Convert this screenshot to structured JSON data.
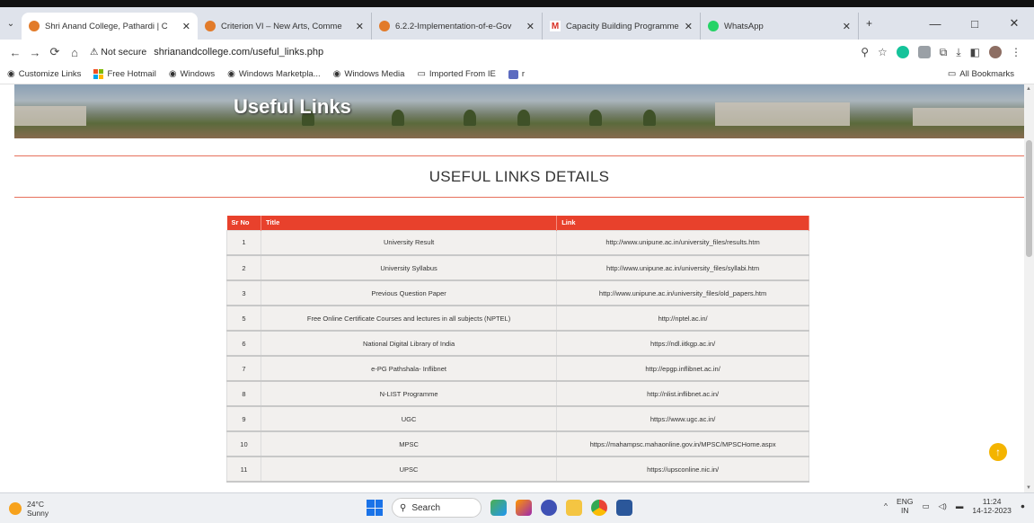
{
  "browser": {
    "tabs": [
      {
        "title": "Shri Anand College, Pathardi | C",
        "active": true,
        "favicon_color": "#e27b2a"
      },
      {
        "title": "Criterion VI – New Arts, Comme",
        "active": false,
        "favicon_color": "#e27b2a"
      },
      {
        "title": "6.2.2-Implementation-of-e-Gov",
        "active": false,
        "favicon_color": "#e27b2a"
      },
      {
        "title": "Capacity Building Programme",
        "active": false,
        "favicon_color": "#d93025"
      },
      {
        "title": "WhatsApp",
        "active": false,
        "favicon_color": "#25d366"
      }
    ],
    "not_secure_label": "Not secure",
    "url": "shrianandcollege.com/useful_links.php",
    "bookmarks": [
      {
        "label": "Customize Links",
        "icon": "globe-icon"
      },
      {
        "label": "Free Hotmail",
        "icon": "windows-flag-icon"
      },
      {
        "label": "Windows",
        "icon": "globe-icon"
      },
      {
        "label": "Windows Marketpla...",
        "icon": "globe-icon"
      },
      {
        "label": "Windows Media",
        "icon": "globe-icon"
      },
      {
        "label": "Imported From IE",
        "icon": "folder-icon"
      },
      {
        "label": "r",
        "icon": "app-icon"
      }
    ],
    "all_bookmarks_label": "All Bookmarks"
  },
  "page": {
    "banner_title": "Useful Links",
    "section_title": "USEFUL LINKS DETAILS",
    "table": {
      "headers": [
        "Sr No",
        "Title",
        "Link"
      ],
      "rows": [
        [
          "1",
          "University Result",
          "http://www.unipune.ac.in/university_files/results.htm"
        ],
        [
          "2",
          "University Syllabus",
          "http://www.unipune.ac.in/university_files/syllabi.htm"
        ],
        [
          "3",
          "Previous Question Paper",
          "http://www.unipune.ac.in/university_files/old_papers.htm"
        ],
        [
          "5",
          "Free Online Certificate Courses and lectures in all subjects (NPTEL)",
          "http://nptel.ac.in/"
        ],
        [
          "6",
          "National Digital Library of India",
          "https://ndl.iitkgp.ac.in/"
        ],
        [
          "7",
          "e-PG Pathshala- Inflibnet",
          "http://epgp.inflibnet.ac.in/"
        ],
        [
          "8",
          "N-LIST Programme",
          "http://nlist.inflibnet.ac.in/"
        ],
        [
          "9",
          "UGC",
          "https://www.ugc.ac.in/"
        ],
        [
          "10",
          "MPSC",
          "https://mahampsc.mahaonline.gov.in/MPSC/MPSCHome.aspx"
        ],
        [
          "11",
          "UPSC",
          "https://upsconline.nic.in/"
        ]
      ]
    }
  },
  "taskbar": {
    "weather_temp": "24°C",
    "weather_desc": "Sunny",
    "search_label": "Search",
    "lang_top": "ENG",
    "lang_bottom": "IN",
    "time": "11:24",
    "date": "14-12-2023"
  },
  "colors": {
    "table_header": "#e8412c",
    "rule": "#e6705c",
    "scroll_top_button": "#f4b400"
  }
}
